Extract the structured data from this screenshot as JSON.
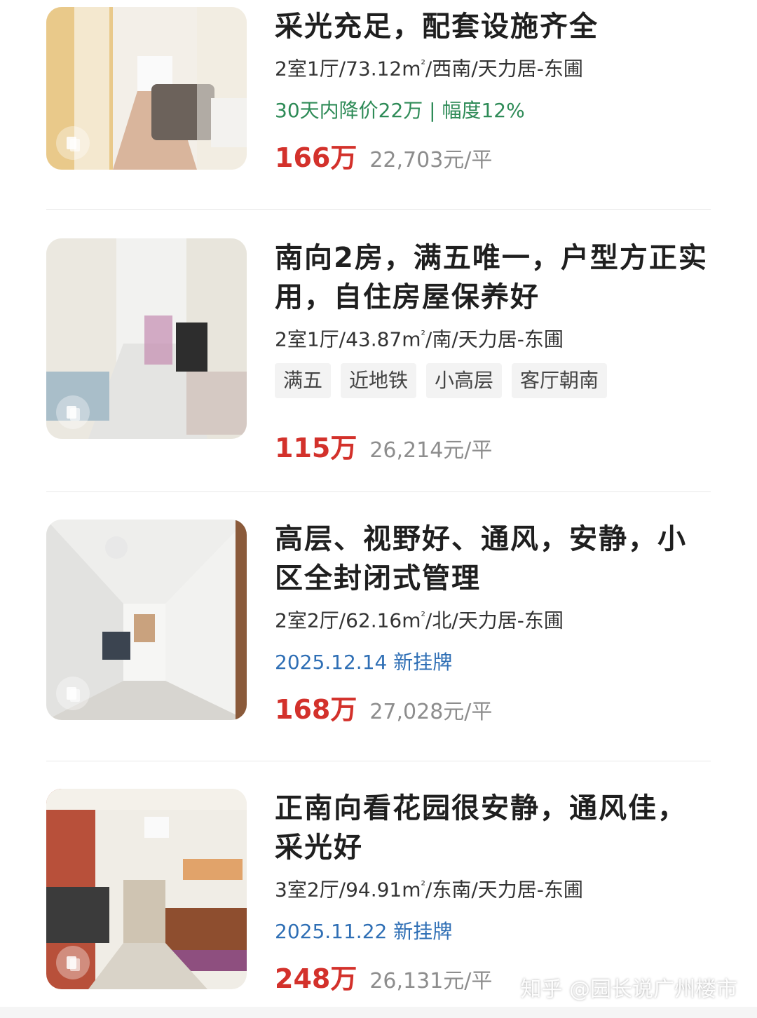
{
  "listings": [
    {
      "title": "采光充足，配套设施齐全",
      "meta_prefix": "2室1厅/73.12m",
      "meta_sup": "²",
      "meta_suffix": "/西南/天力居-东圃",
      "price_drop": "30天内降价22万 | 幅度12%",
      "price": "166万",
      "unit_price": "22,703元/平"
    },
    {
      "title": "南向2房，满五唯一，户型方正实用，自住房屋保养好",
      "meta_prefix": "2室1厅/43.87m",
      "meta_sup": "²",
      "meta_suffix": "/南/天力居-东圃",
      "tags": [
        "满五",
        "近地铁",
        "小高层",
        "客厅朝南"
      ],
      "price": "115万",
      "unit_price": "26,214元/平"
    },
    {
      "title": "高层、视野好、通风，安静，小区全封闭式管理",
      "meta_prefix": "2室2厅/62.16m",
      "meta_sup": "²",
      "meta_suffix": "/北/天力居-东圃",
      "listed": "2025.12.14 新挂牌",
      "price": "168万",
      "unit_price": "27,028元/平"
    },
    {
      "title": "正南向看花园很安静，通风佳，采光好",
      "meta_prefix": "3室2厅/94.91m",
      "meta_sup": "²",
      "meta_suffix": "/东南/天力居-东圃",
      "listed": "2025.11.22 新挂牌",
      "price": "248万",
      "unit_price": "26,131元/平"
    }
  ],
  "watermark": "知乎 @园长说广州楼市",
  "colors": {
    "price": "#d3312b",
    "drop": "#2e8b57",
    "new_listing": "#2f6fb5"
  }
}
